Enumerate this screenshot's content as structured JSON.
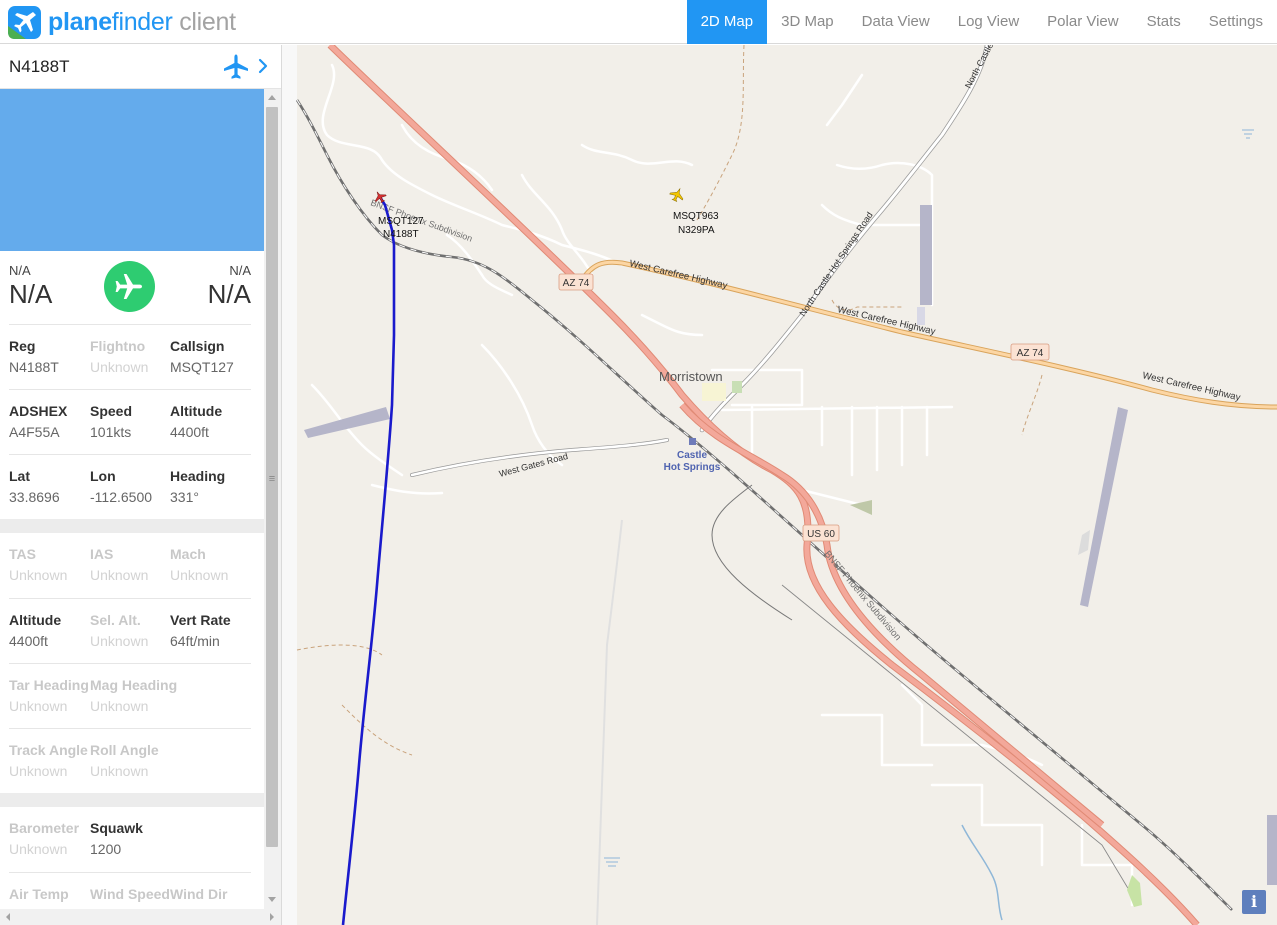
{
  "app": {
    "logo_word1": "plane",
    "logo_word2": "finder",
    "logo_word3": " client",
    "brand_color": "#2196f3"
  },
  "nav": {
    "tabs": [
      "2D Map",
      "3D Map",
      "Data View",
      "Log View",
      "Polar View",
      "Stats",
      "Settings"
    ],
    "active": "2D Map"
  },
  "selected": {
    "registration": "N4188T",
    "route": {
      "from_label": "N/A",
      "from_code": "N/A",
      "to_label": "N/A",
      "to_code": "N/A"
    },
    "rows": [
      [
        {
          "label": "Reg",
          "value": "N4188T",
          "known": true
        },
        {
          "label": "Flightno",
          "value": "Unknown",
          "known": false
        },
        {
          "label": "Callsign",
          "value": "MSQT127",
          "known": true
        }
      ],
      [
        {
          "label": "ADSHEX",
          "value": "A4F55A",
          "known": true
        },
        {
          "label": "Speed",
          "value": "101kts",
          "known": true
        },
        {
          "label": "Altitude",
          "value": "4400ft",
          "known": true
        }
      ],
      [
        {
          "label": "Lat",
          "value": "33.8696",
          "known": true
        },
        {
          "label": "Lon",
          "value": "-112.6500",
          "known": true
        },
        {
          "label": "Heading",
          "value": "331°",
          "known": true
        }
      ],
      [
        {
          "label": "TAS",
          "value": "Unknown",
          "known": false
        },
        {
          "label": "IAS",
          "value": "Unknown",
          "known": false
        },
        {
          "label": "Mach",
          "value": "Unknown",
          "known": false
        }
      ],
      [
        {
          "label": "Altitude",
          "value": "4400ft",
          "known": true
        },
        {
          "label": "Sel. Alt.",
          "value": "Unknown",
          "known": false
        },
        {
          "label": "Vert Rate",
          "value": "64ft/min",
          "known": true
        }
      ],
      [
        {
          "label": "Tar Heading",
          "value": "Unknown",
          "known": false
        },
        {
          "label": "Mag Heading",
          "value": "Unknown",
          "known": false
        }
      ],
      [
        {
          "label": "Track Angle",
          "value": "Unknown",
          "known": false
        },
        {
          "label": "Roll Angle",
          "value": "Unknown",
          "known": false
        }
      ],
      [
        {
          "label": "Barometer",
          "value": "Unknown",
          "known": false
        },
        {
          "label": "Squawk",
          "value": "1200",
          "known": true
        }
      ],
      [
        {
          "label": "Air Temp",
          "value": "",
          "known": false
        },
        {
          "label": "Wind Speed",
          "value": "",
          "known": false
        },
        {
          "label": "Wind Dir",
          "value": "",
          "known": false
        }
      ]
    ]
  },
  "map": {
    "aircraft": [
      {
        "callsign": "MSQT127",
        "reg": "N4188T",
        "color": "#d32f2f"
      },
      {
        "callsign": "MSQT963",
        "reg": "N329PA",
        "color": "#e6b800"
      }
    ],
    "places": {
      "morristown": "Morristown",
      "castle_1": "Castle",
      "castle_2": "Hot Springs"
    },
    "roads": {
      "west_carefree_1": "West Carefree Highway",
      "west_carefree_2": "West Carefree Highway",
      "west_carefree_3": "West Carefree Highway",
      "north_castle_hs": "North Castle Hot Springs Road",
      "north_castle": "North Castle",
      "west_gates": "West Gates Road",
      "bnsf_1": "BNSF Phoenix Subdivision",
      "bnsf_2": "BNSF Phoenix Subdivision"
    },
    "shields": {
      "az74_a": "AZ 74",
      "az74_b": "AZ 74",
      "us60": "US 60"
    },
    "track_color": "#1a1acc",
    "info_label": "i"
  }
}
